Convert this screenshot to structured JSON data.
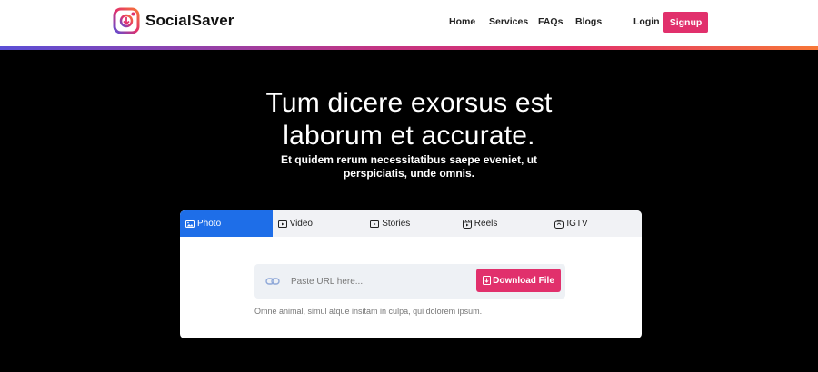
{
  "colors": {
    "accent": "#e1306c",
    "tab_active": "#1e6ee8",
    "background": "#000000"
  },
  "brand": {
    "name": "SocialSaver",
    "icon": "instagram-download-icon"
  },
  "nav": {
    "items": [
      {
        "label": "Home"
      },
      {
        "label": "Services"
      },
      {
        "label": "FAQs"
      },
      {
        "label": "Blogs"
      }
    ],
    "login": "Login",
    "signup": "Signup"
  },
  "hero": {
    "title_line1": "Tum dicere exorsus est",
    "title_line2": "laborum et accurate.",
    "subtitle": "Et quidem rerum necessitatibus saepe eveniet, ut perspiciatis, unde omnis."
  },
  "downloader": {
    "tabs": [
      {
        "label": "Photo",
        "icon": "image-icon",
        "active": true
      },
      {
        "label": "Video",
        "icon": "play-icon",
        "active": false
      },
      {
        "label": "Stories",
        "icon": "play-icon",
        "active": false
      },
      {
        "label": "Reels",
        "icon": "reels-icon",
        "active": false
      },
      {
        "label": "IGTV",
        "icon": "igtv-icon",
        "active": false
      }
    ],
    "url_placeholder": "Paste URL here...",
    "url_value": "",
    "download_label": "Download File",
    "caption": "Omne animal, simul atque insitam in culpa, qui dolorem ipsum."
  }
}
